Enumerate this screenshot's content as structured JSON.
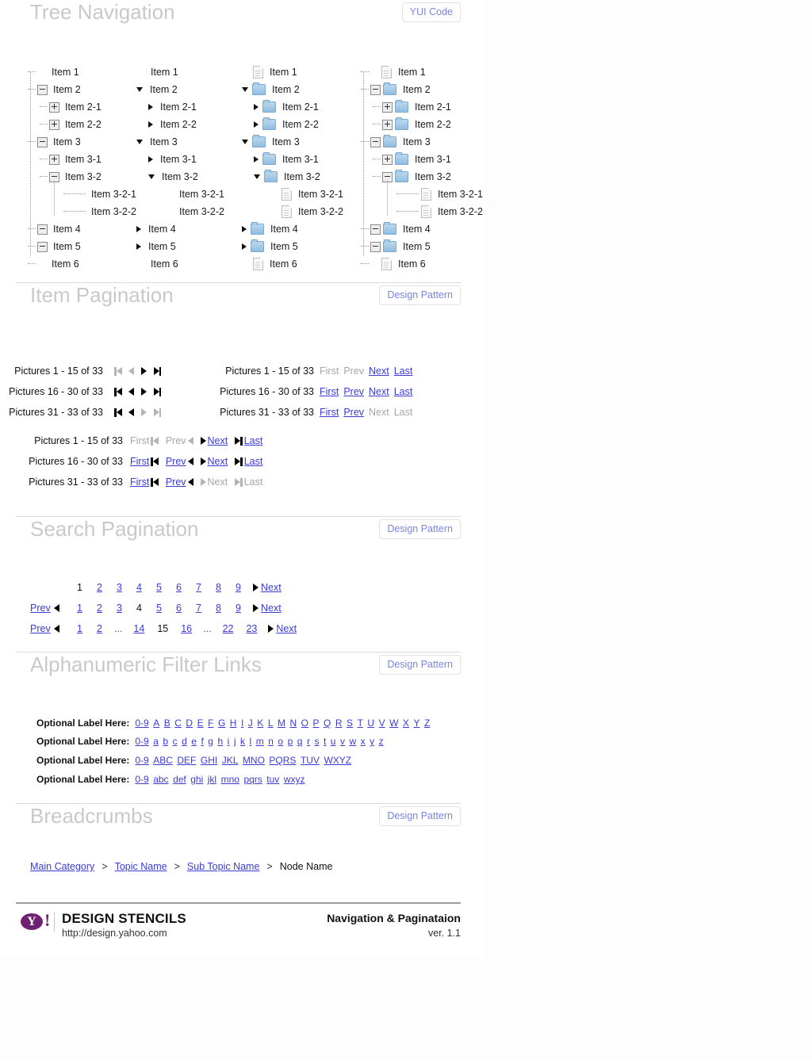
{
  "sections": {
    "tree": {
      "title": "Tree Navigation",
      "button": "YUI Code",
      "columns": [
        {
          "style": "dotted-plusminus",
          "nodes": [
            {
              "label": "Item 1",
              "depth": 0,
              "toggle": "none"
            },
            {
              "label": "Item 2",
              "depth": 0,
              "toggle": "minus"
            },
            {
              "label": "Item 2-1",
              "depth": 1,
              "toggle": "plus"
            },
            {
              "label": "Item 2-2",
              "depth": 1,
              "toggle": "plus"
            },
            {
              "label": "Item 3",
              "depth": 0,
              "toggle": "minus"
            },
            {
              "label": "Item 3-1",
              "depth": 1,
              "toggle": "plus"
            },
            {
              "label": "Item 3-2",
              "depth": 1,
              "toggle": "minus"
            },
            {
              "label": "Item 3-2-1",
              "depth": 2,
              "toggle": "none"
            },
            {
              "label": "Item 3-2-2",
              "depth": 2,
              "toggle": "none"
            },
            {
              "label": "Item 4",
              "depth": 0,
              "toggle": "minus"
            },
            {
              "label": "Item 5",
              "depth": 0,
              "toggle": "minus"
            },
            {
              "label": "Item 6",
              "depth": 0,
              "toggle": "none"
            }
          ]
        },
        {
          "style": "triangles",
          "nodes": [
            {
              "label": "Item 1",
              "depth": 0,
              "toggle": "none"
            },
            {
              "label": "Item 2",
              "depth": 0,
              "toggle": "down"
            },
            {
              "label": "Item 2-1",
              "depth": 1,
              "toggle": "right"
            },
            {
              "label": "Item 2-2",
              "depth": 1,
              "toggle": "right"
            },
            {
              "label": "Item 3",
              "depth": 0,
              "toggle": "down"
            },
            {
              "label": "Item 3-1",
              "depth": 1,
              "toggle": "right"
            },
            {
              "label": "Item 3-2",
              "depth": 1,
              "toggle": "down"
            },
            {
              "label": "Item 3-2-1",
              "depth": 2,
              "toggle": "none"
            },
            {
              "label": "Item 3-2-2",
              "depth": 2,
              "toggle": "none"
            },
            {
              "label": "Item 4",
              "depth": 0,
              "toggle": "right"
            },
            {
              "label": "Item 5",
              "depth": 0,
              "toggle": "right"
            },
            {
              "label": "Item 6",
              "depth": 0,
              "toggle": "none"
            }
          ]
        },
        {
          "style": "triangles-icons",
          "nodes": [
            {
              "label": "Item 1",
              "depth": 0,
              "toggle": "none",
              "icon": "document-icon"
            },
            {
              "label": "Item 2",
              "depth": 0,
              "toggle": "down",
              "icon": "folder-icon"
            },
            {
              "label": "Item 2-1",
              "depth": 1,
              "toggle": "right",
              "icon": "folder-icon"
            },
            {
              "label": "Item 2-2",
              "depth": 1,
              "toggle": "right",
              "icon": "folder-icon"
            },
            {
              "label": "Item 3",
              "depth": 0,
              "toggle": "down",
              "icon": "folder-icon"
            },
            {
              "label": "Item 3-1",
              "depth": 1,
              "toggle": "right",
              "icon": "folder-icon"
            },
            {
              "label": "Item 3-2",
              "depth": 1,
              "toggle": "down",
              "icon": "folder-icon"
            },
            {
              "label": "Item 3-2-1",
              "depth": 2,
              "toggle": "none",
              "icon": "document-icon"
            },
            {
              "label": "Item 3-2-2",
              "depth": 2,
              "toggle": "none",
              "icon": "document-icon"
            },
            {
              "label": "Item 4",
              "depth": 0,
              "toggle": "right",
              "icon": "folder-icon"
            },
            {
              "label": "Item 5",
              "depth": 0,
              "toggle": "right",
              "icon": "folder-icon"
            },
            {
              "label": "Item 6",
              "depth": 0,
              "toggle": "none",
              "icon": "document-icon"
            }
          ]
        },
        {
          "style": "dotted-plusminus-icons",
          "nodes": [
            {
              "label": "Item 1",
              "depth": 0,
              "toggle": "none",
              "icon": "document-icon"
            },
            {
              "label": "Item 2",
              "depth": 0,
              "toggle": "minus",
              "icon": "folder-icon"
            },
            {
              "label": "Item 2-1",
              "depth": 1,
              "toggle": "plus",
              "icon": "folder-icon"
            },
            {
              "label": "Item 2-2",
              "depth": 1,
              "toggle": "plus",
              "icon": "folder-icon"
            },
            {
              "label": "Item 3",
              "depth": 0,
              "toggle": "minus",
              "icon": "folder-icon"
            },
            {
              "label": "Item 3-1",
              "depth": 1,
              "toggle": "plus",
              "icon": "folder-icon"
            },
            {
              "label": "Item 3-2",
              "depth": 1,
              "toggle": "minus",
              "icon": "folder-icon"
            },
            {
              "label": "Item 3-2-1",
              "depth": 2,
              "toggle": "none",
              "icon": "document-icon"
            },
            {
              "label": "Item 3-2-2",
              "depth": 2,
              "toggle": "none",
              "icon": "document-icon"
            },
            {
              "label": "Item 4",
              "depth": 0,
              "toggle": "minus",
              "icon": "folder-icon"
            },
            {
              "label": "Item 5",
              "depth": 0,
              "toggle": "minus",
              "icon": "folder-icon"
            },
            {
              "label": "Item 6",
              "depth": 0,
              "toggle": "none",
              "icon": "document-icon"
            }
          ]
        }
      ]
    },
    "item_pagination": {
      "title": "Item Pagination",
      "button": "Design Pattern",
      "icon_rows": [
        {
          "count": "Pictures 1 - 15 of 33",
          "first": "off",
          "prev": "off",
          "next": "on",
          "last": "on"
        },
        {
          "count": "Pictures 16 - 30 of 33",
          "first": "on",
          "prev": "on",
          "next": "on",
          "last": "on"
        },
        {
          "count": "Pictures 31 - 33 of 33",
          "first": "on",
          "prev": "on",
          "next": "off",
          "last": "off"
        }
      ],
      "text_rows": [
        {
          "count": "Pictures 1 - 15 of 33",
          "first": {
            "label": "First",
            "state": "off"
          },
          "prev": {
            "label": "Prev",
            "state": "off"
          },
          "next": {
            "label": "Next",
            "state": "on"
          },
          "last": {
            "label": "Last",
            "state": "on"
          }
        },
        {
          "count": "Pictures 16 - 30 of 33",
          "first": {
            "label": "First",
            "state": "on"
          },
          "prev": {
            "label": "Prev",
            "state": "on"
          },
          "next": {
            "label": "Next",
            "state": "on"
          },
          "last": {
            "label": "Last",
            "state": "on"
          }
        },
        {
          "count": "Pictures 31 - 33 of 33",
          "first": {
            "label": "First",
            "state": "on"
          },
          "prev": {
            "label": "Prev",
            "state": "on"
          },
          "next": {
            "label": "Next",
            "state": "off"
          },
          "last": {
            "label": "Last",
            "state": "off"
          }
        }
      ],
      "combo_rows": [
        {
          "count": "Pictures 1 - 15 of 33",
          "first": {
            "label": "First",
            "state": "off"
          },
          "prev": {
            "label": "Prev",
            "state": "off"
          },
          "next": {
            "label": "Next",
            "state": "on"
          },
          "last": {
            "label": "Last",
            "state": "on"
          }
        },
        {
          "count": "Pictures 16 - 30 of 33",
          "first": {
            "label": "First",
            "state": "on"
          },
          "prev": {
            "label": "Prev",
            "state": "on"
          },
          "next": {
            "label": "Next",
            "state": "on"
          },
          "last": {
            "label": "Last",
            "state": "on"
          }
        },
        {
          "count": "Pictures 31 - 33 of 33",
          "first": {
            "label": "First",
            "state": "on"
          },
          "prev": {
            "label": "Prev",
            "state": "on"
          },
          "next": {
            "label": "Next",
            "state": "off"
          },
          "last": {
            "label": "Last",
            "state": "off"
          }
        }
      ]
    },
    "search_pagination": {
      "title": "Search Pagination",
      "button": "Design Pattern",
      "rows": [
        {
          "prev": null,
          "next": "Next",
          "pages": [
            {
              "label": "1",
              "current": true
            },
            {
              "label": "2",
              "current": false
            },
            {
              "label": "3",
              "current": false
            },
            {
              "label": "4",
              "current": false
            },
            {
              "label": "5",
              "current": false
            },
            {
              "label": "6",
              "current": false
            },
            {
              "label": "7",
              "current": false
            },
            {
              "label": "8",
              "current": false
            },
            {
              "label": "9",
              "current": false
            }
          ]
        },
        {
          "prev": "Prev",
          "next": "Next",
          "pages": [
            {
              "label": "1",
              "current": false
            },
            {
              "label": "2",
              "current": false
            },
            {
              "label": "3",
              "current": false
            },
            {
              "label": "4",
              "current": true
            },
            {
              "label": "5",
              "current": false
            },
            {
              "label": "6",
              "current": false
            },
            {
              "label": "7",
              "current": false
            },
            {
              "label": "8",
              "current": false
            },
            {
              "label": "9",
              "current": false
            }
          ]
        },
        {
          "prev": "Prev",
          "next": "Next",
          "pages": [
            {
              "label": "1",
              "current": false
            },
            {
              "label": "2",
              "current": false
            },
            {
              "label": "...",
              "ellipsis": true
            },
            {
              "label": "14",
              "current": false
            },
            {
              "label": "15",
              "current": true
            },
            {
              "label": "16",
              "current": false
            },
            {
              "label": "...",
              "ellipsis": true
            },
            {
              "label": "22",
              "current": false
            },
            {
              "label": "23",
              "current": false
            }
          ]
        }
      ]
    },
    "alpha_filter": {
      "title": "Alphanumeric Filter Links",
      "button": "Design Pattern",
      "rows": [
        {
          "label": "Optional Label Here:",
          "items": [
            "0-9",
            "A",
            "B",
            "C",
            "D",
            "E",
            "F",
            "G",
            "H",
            "I",
            "J",
            "K",
            "L",
            "M",
            "N",
            "O",
            "P",
            "Q",
            "R",
            "S",
            "T",
            "U",
            "V",
            "W",
            "X",
            "Y",
            "Z"
          ]
        },
        {
          "label": "Optional Label Here:",
          "items": [
            "0-9",
            "a",
            "b",
            "c",
            "d",
            "e",
            "f",
            "g",
            "h",
            "i",
            "j",
            "k",
            "l",
            "m",
            "n",
            "o",
            "p",
            "q",
            "r",
            "s",
            "t",
            "u",
            "v",
            "w",
            "x",
            "y",
            "z"
          ]
        },
        {
          "label": "Optional Label Here:",
          "items": [
            "0-9",
            "ABC",
            "DEF",
            "GHI",
            "JKL",
            "MNO",
            "PQRS",
            "TUV",
            "WXYZ"
          ]
        },
        {
          "label": "Optional Label Here:",
          "items": [
            "0-9",
            "abc",
            "def",
            "ghi",
            "jkl",
            "mno",
            "pqrs",
            "tuv",
            "wxyz"
          ]
        }
      ]
    },
    "breadcrumbs": {
      "title": "Breadcrumbs",
      "button": "Design Pattern",
      "separator": ">",
      "crumbs": [
        {
          "label": "Main Category",
          "current": false
        },
        {
          "label": "Topic Name",
          "current": false
        },
        {
          "label": "Sub Topic Name",
          "current": false
        },
        {
          "label": "Node Name",
          "current": true
        }
      ]
    }
  },
  "footer": {
    "logo_letter": "Y",
    "logo_bang": "!",
    "brand": "DESIGN STENCILS",
    "url": "http://design.yahoo.com",
    "doc_title": "Navigation & Paginataion",
    "version": "ver. 1.1",
    "logo_color": "#6f2171"
  }
}
